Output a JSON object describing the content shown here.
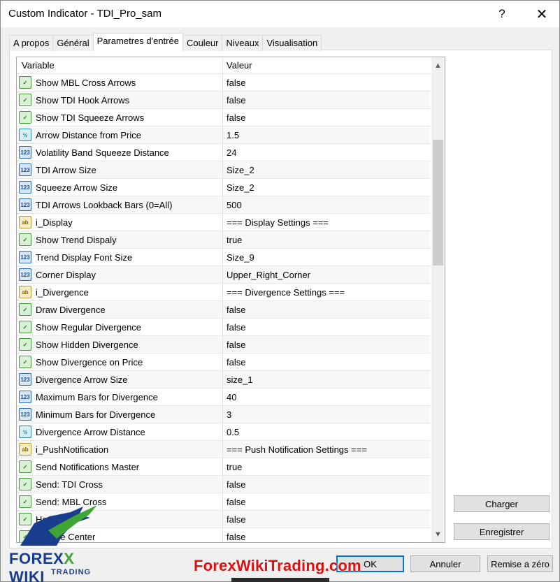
{
  "window": {
    "title": "Custom Indicator - TDI_Pro_sam",
    "help_glyph": "?",
    "close_glyph": "✕"
  },
  "tabs": [
    "A propos",
    "Général",
    "Parametres d'entrée",
    "Couleur",
    "Niveaux",
    "Visualisation"
  ],
  "grid": {
    "header": {
      "variable": "Variable",
      "value": "Valeur"
    },
    "rows": [
      {
        "type": "bool",
        "icon": "bool-icon",
        "name": "Show MBL Cross Arrows",
        "value": "false"
      },
      {
        "type": "bool",
        "icon": "bool-icon",
        "name": "Show TDI Hook Arrows",
        "value": "false"
      },
      {
        "type": "bool",
        "icon": "bool-icon",
        "name": "Show TDI Squeeze Arrows",
        "value": "false"
      },
      {
        "type": "dbl",
        "icon": "double-icon",
        "name": "Arrow Distance from Price",
        "value": "1.5"
      },
      {
        "type": "int",
        "icon": "integer-icon",
        "name": "Volatility Band Squeeze Distance",
        "value": "24"
      },
      {
        "type": "int",
        "icon": "integer-icon",
        "name": "TDI Arrow Size",
        "value": "Size_2"
      },
      {
        "type": "int",
        "icon": "integer-icon",
        "name": "Squeeze Arrow Size",
        "value": "Size_2"
      },
      {
        "type": "int",
        "icon": "integer-icon",
        "name": "TDI Arrows Lookback Bars  (0=All)",
        "value": "500"
      },
      {
        "type": "str",
        "icon": "string-icon",
        "name": "i_Display",
        "value": "=== Display Settings ==="
      },
      {
        "type": "bool",
        "icon": "bool-icon",
        "name": "Show Trend Dispaly",
        "value": "true"
      },
      {
        "type": "int",
        "icon": "integer-icon",
        "name": "Trend Display Font Size",
        "value": "Size_9"
      },
      {
        "type": "int",
        "icon": "integer-icon",
        "name": "Corner Display",
        "value": "Upper_Right_Corner"
      },
      {
        "type": "str",
        "icon": "string-icon",
        "name": "i_Divergence",
        "value": "=== Divergence Settings ==="
      },
      {
        "type": "bool",
        "icon": "bool-icon",
        "name": "Draw Divergence",
        "value": "false"
      },
      {
        "type": "bool",
        "icon": "bool-icon",
        "name": "Show Regular Divergence",
        "value": "false"
      },
      {
        "type": "bool",
        "icon": "bool-icon",
        "name": "Show Hidden Divergence",
        "value": "false"
      },
      {
        "type": "bool",
        "icon": "bool-icon",
        "name": "Show Divergence on Price",
        "value": "false"
      },
      {
        "type": "int",
        "icon": "integer-icon",
        "name": "Divergence Arrow Size",
        "value": "size_1"
      },
      {
        "type": "int",
        "icon": "integer-icon",
        "name": "Maximum Bars for Divergence",
        "value": "40"
      },
      {
        "type": "int",
        "icon": "integer-icon",
        "name": "Minimum Bars for Divergence",
        "value": "3"
      },
      {
        "type": "dbl",
        "icon": "double-icon",
        "name": "Divergence Arrow Distance",
        "value": "0.5"
      },
      {
        "type": "str",
        "icon": "string-icon",
        "name": "i_PushNotification",
        "value": "=== Push Notification Settings ==="
      },
      {
        "type": "bool",
        "icon": "bool-icon",
        "name": "Send Notifications Master",
        "value": "true"
      },
      {
        "type": "bool",
        "icon": "bool-icon",
        "name": "Send: TDI Cross",
        "value": "false"
      },
      {
        "type": "bool",
        "icon": "bool-icon",
        "name": "Send: MBL Cross",
        "value": "false"
      },
      {
        "type": "bool",
        "icon": "bool-icon",
        "name": "Hook",
        "value": "false"
      },
      {
        "type": "bool",
        "icon": "bool-icon",
        "name": "queeze Center",
        "value": "false"
      }
    ]
  },
  "buttons": {
    "charger": "Charger",
    "enregistrer": "Enregistrer",
    "ok": "OK",
    "annuler": "Annuler",
    "reset": "Remise a zéro"
  },
  "watermark": {
    "site": "ForexWikiTrading.com",
    "logo_main": "FOREX",
    "logo_x": "X",
    "logo_wiki": "WIKI",
    "logo_sub": "TRADING"
  },
  "icon_glyphs": {
    "bool": "✓",
    "int": "123",
    "dbl": "½",
    "str": "ab"
  }
}
